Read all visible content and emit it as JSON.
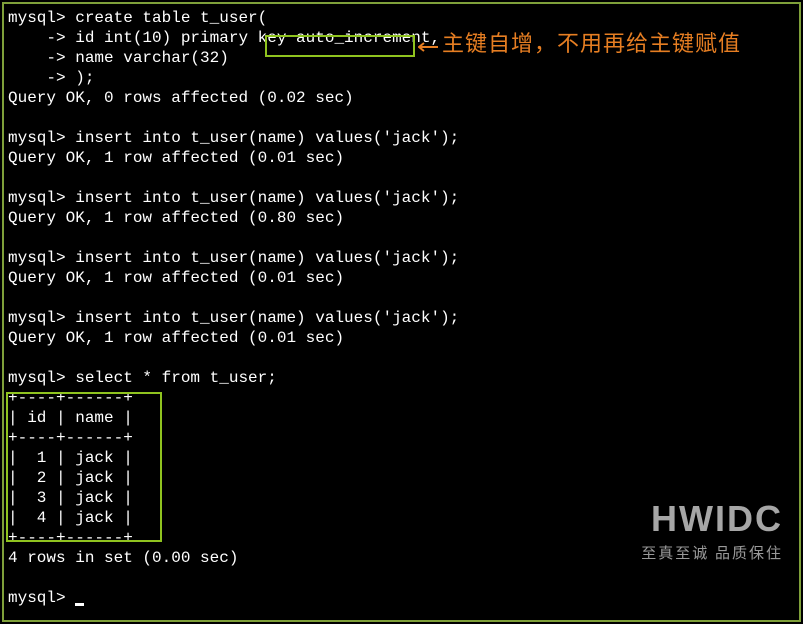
{
  "annotation": {
    "text": "主键自增，不用再给主键赋值",
    "highlighted_keyword": "auto_increment,"
  },
  "chart_data": {
    "type": "table",
    "title": "select * from t_user;",
    "columns": [
      "id",
      "name"
    ],
    "rows": [
      {
        "id": 1,
        "name": "jack"
      },
      {
        "id": 2,
        "name": "jack"
      },
      {
        "id": 3,
        "name": "jack"
      },
      {
        "id": 4,
        "name": "jack"
      }
    ],
    "footer": "4 rows in set (0.00 sec)"
  },
  "terminal": {
    "create": {
      "l1": "mysql> create table t_user(",
      "l2": "    -> id int(10) primary key auto_increment,",
      "l3": "    -> name varchar(32)",
      "l4": "    -> );",
      "result": "Query OK, 0 rows affected (0.02 sec)"
    },
    "inserts": [
      {
        "cmd": "mysql> insert into t_user(name) values('jack');",
        "result": "Query OK, 1 row affected (0.01 sec)"
      },
      {
        "cmd": "mysql> insert into t_user(name) values('jack');",
        "result": "Query OK, 1 row affected (0.80 sec)"
      },
      {
        "cmd": "mysql> insert into t_user(name) values('jack');",
        "result": "Query OK, 1 row affected (0.01 sec)"
      },
      {
        "cmd": "mysql> insert into t_user(name) values('jack');",
        "result": "Query OK, 1 row affected (0.01 sec)"
      }
    ],
    "select": {
      "cmd": "mysql> select * from t_user;",
      "border": "+----+------+",
      "header": "| id | name |",
      "rows": [
        "|  1 | jack |",
        "|  2 | jack |",
        "|  3 | jack |",
        "|  4 | jack |"
      ],
      "footer": "4 rows in set (0.00 sec)"
    },
    "prompt": "mysql> "
  },
  "watermark": {
    "title": "HWIDC",
    "subtitle": "至真至诚 品质保住"
  }
}
